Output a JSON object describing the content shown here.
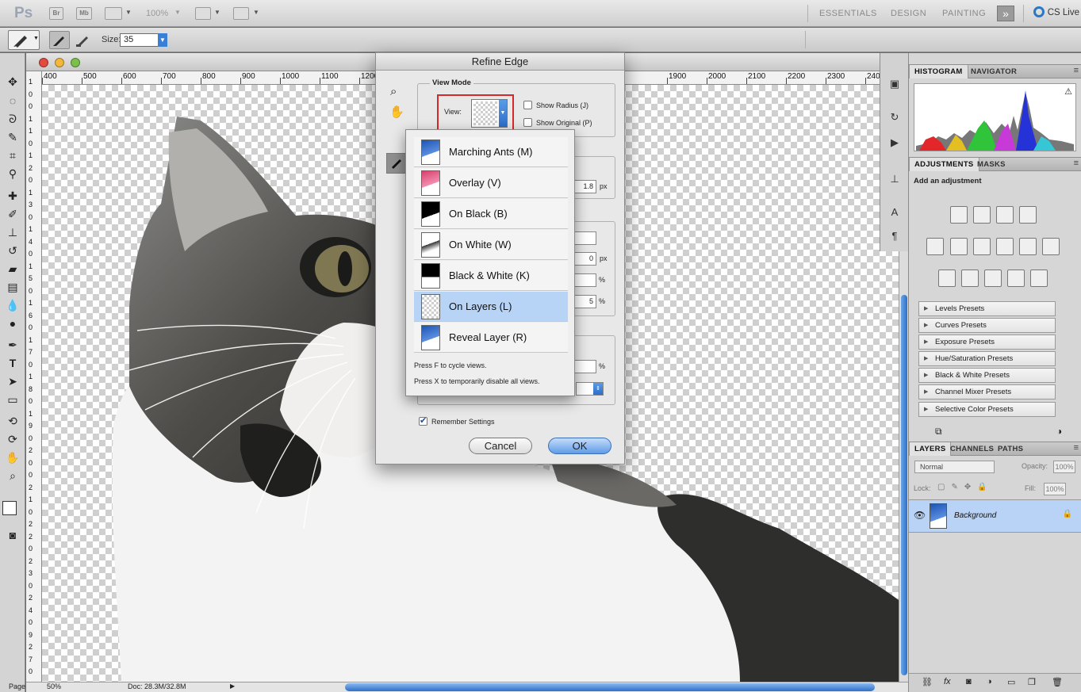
{
  "app": {
    "logo": "Ps",
    "bridge_label": "Br",
    "minibridge_label": "Mb",
    "zoom_label": "100%",
    "workspaces": [
      "ESSENTIALS",
      "DESIGN",
      "PAINTING"
    ],
    "more_workspaces": "»",
    "cslive_label": "CS Live"
  },
  "options": {
    "size_label": "Size:",
    "size_value": "35"
  },
  "document": {
    "ruler_h_labels": [
      "400",
      "500",
      "600",
      "700",
      "800",
      "900",
      "1000",
      "1100",
      "1200",
      "1900",
      "2000",
      "2100",
      "2200",
      "2300",
      "2400"
    ],
    "ruler_v_labels": [
      "1",
      "0",
      "0",
      "1",
      "1",
      "0",
      "1",
      "2",
      "0",
      "1",
      "3",
      "0",
      "1",
      "4",
      "0",
      "1",
      "5",
      "0",
      "1",
      "6",
      "0",
      "1",
      "7",
      "0",
      "1",
      "8",
      "0",
      "1",
      "9",
      "0",
      "2",
      "0",
      "0",
      "2",
      "1",
      "0",
      "2",
      "2",
      "0",
      "2",
      "3",
      "0",
      "2",
      "4",
      "0",
      "9",
      "2",
      "7",
      "0"
    ],
    "status_zoom": "50%",
    "status_doc": "Doc: 28.3M/32.8M",
    "status_left": "Page"
  },
  "dialog": {
    "title": "Refine Edge",
    "view_mode_label": "View Mode",
    "view_label": "View:",
    "show_radius": "Show Radius (J)",
    "show_original": "Show Original (P)",
    "field_values": [
      "1.8",
      "",
      "0",
      "",
      "5",
      "",
      ""
    ],
    "units": [
      "px",
      "px",
      "%",
      "%",
      "%"
    ],
    "remember_label": "Remember Settings",
    "cancel_label": "Cancel",
    "ok_label": "OK"
  },
  "dropdown": {
    "options": [
      {
        "label": "Marching Ants (M)",
        "thumb": "blue"
      },
      {
        "label": "Overlay (V)",
        "thumb": "pink"
      },
      {
        "label": "On Black (B)",
        "thumb": "black"
      },
      {
        "label": "On White (W)",
        "thumb": "white"
      },
      {
        "label": "Black & White (K)",
        "thumb": "bw"
      },
      {
        "label": "On Layers (L)",
        "thumb": "checker"
      },
      {
        "label": "Reveal Layer (R)",
        "thumb": "blue"
      }
    ],
    "selected_index": 5,
    "hint_cycle": "Press F to cycle views.",
    "hint_disable": "Press X to temporarily disable all views."
  },
  "panels": {
    "top_tabs": [
      "HISTOGRAM",
      "NAVIGATOR"
    ],
    "adj_tabs": [
      "ADJUSTMENTS",
      "MASKS"
    ],
    "add_adjustment": "Add an adjustment",
    "presets": [
      "Levels Presets",
      "Curves Presets",
      "Exposure Presets",
      "Hue/Saturation Presets",
      "Black & White Presets",
      "Channel Mixer Presets",
      "Selective Color Presets"
    ],
    "layer_tabs": [
      "LAYERS",
      "CHANNELS",
      "PATHS"
    ],
    "blend_mode": "Normal",
    "opacity_label": "Opacity:",
    "opacity_value": "100%",
    "lock_label": "Lock:",
    "fill_label": "Fill:",
    "fill_value": "100%",
    "layer_name": "Background"
  },
  "colors": {
    "accent": "#2d6fc9",
    "selection": "#b7d3f6",
    "highlight_border": "#d62a2a"
  }
}
